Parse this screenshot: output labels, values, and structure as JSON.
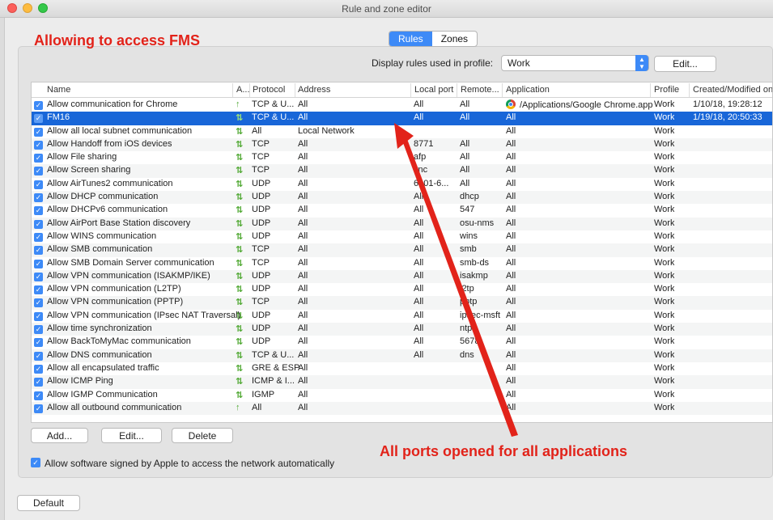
{
  "window": {
    "title": "Rule and zone editor"
  },
  "tabs": {
    "rules": "Rules",
    "zones": "Zones"
  },
  "profile": {
    "label": "Display rules used in profile:",
    "selected": "Work",
    "edit_button": "Edit..."
  },
  "table": {
    "headers": [
      "Name",
      "A...",
      "Protocol",
      "Address",
      "Local port",
      "Remote...",
      "Application",
      "Profile",
      "Created/Modified on"
    ],
    "rows": [
      {
        "name": "Allow communication for Chrome",
        "dir": "up",
        "protocol": "TCP & U...",
        "address": "All",
        "local": "All",
        "remote": "All",
        "app": "/Applications/Google Chrome.app",
        "app_icon": "chrome-icon",
        "profile": "Work",
        "created": "1/10/18, 19:28:12"
      },
      {
        "name": "FM16",
        "dir": "both",
        "protocol": "TCP & U...",
        "address": "All",
        "local": "All",
        "remote": "All",
        "app": "All",
        "profile": "Work",
        "created": "1/19/18, 20:50:33",
        "selected": true
      },
      {
        "name": "Allow all local subnet communication",
        "dir": "both",
        "protocol": "All",
        "address": "Local Network",
        "local": "",
        "remote": "",
        "app": "All",
        "profile": "Work",
        "created": ""
      },
      {
        "name": "Allow Handoff from iOS devices",
        "dir": "both",
        "protocol": "TCP",
        "address": "All",
        "local": "8771",
        "remote": "All",
        "app": "All",
        "profile": "Work",
        "created": ""
      },
      {
        "name": "Allow File sharing",
        "dir": "both",
        "protocol": "TCP",
        "address": "All",
        "local": "afp",
        "remote": "All",
        "app": "All",
        "profile": "Work",
        "created": ""
      },
      {
        "name": "Allow Screen sharing",
        "dir": "both",
        "protocol": "TCP",
        "address": "All",
        "local": "vnc",
        "remote": "All",
        "app": "All",
        "profile": "Work",
        "created": ""
      },
      {
        "name": "Allow AirTunes2 communication",
        "dir": "both",
        "protocol": "UDP",
        "address": "All",
        "local": "6001-6...",
        "remote": "All",
        "app": "All",
        "profile": "Work",
        "created": ""
      },
      {
        "name": "Allow DHCP communication",
        "dir": "both",
        "protocol": "UDP",
        "address": "All",
        "local": "All",
        "remote": "dhcp",
        "app": "All",
        "profile": "Work",
        "created": ""
      },
      {
        "name": "Allow DHCPv6 communication",
        "dir": "both",
        "protocol": "UDP",
        "address": "All",
        "local": "All",
        "remote": "547",
        "app": "All",
        "profile": "Work",
        "created": ""
      },
      {
        "name": "Allow AirPort Base Station discovery",
        "dir": "both",
        "protocol": "UDP",
        "address": "All",
        "local": "All",
        "remote": "osu-nms",
        "app": "All",
        "profile": "Work",
        "created": ""
      },
      {
        "name": "Allow WINS communication",
        "dir": "both",
        "protocol": "UDP",
        "address": "All",
        "local": "All",
        "remote": "wins",
        "app": "All",
        "profile": "Work",
        "created": ""
      },
      {
        "name": "Allow SMB communication",
        "dir": "both",
        "protocol": "TCP",
        "address": "All",
        "local": "All",
        "remote": "smb",
        "app": "All",
        "profile": "Work",
        "created": ""
      },
      {
        "name": "Allow SMB Domain Server communication",
        "dir": "both",
        "protocol": "TCP",
        "address": "All",
        "local": "All",
        "remote": "smb-ds",
        "app": "All",
        "profile": "Work",
        "created": ""
      },
      {
        "name": "Allow VPN communication (ISAKMP/IKE)",
        "dir": "both",
        "protocol": "UDP",
        "address": "All",
        "local": "All",
        "remote": "isakmp",
        "app": "All",
        "profile": "Work",
        "created": ""
      },
      {
        "name": "Allow VPN communication (L2TP)",
        "dir": "both",
        "protocol": "UDP",
        "address": "All",
        "local": "All",
        "remote": "l2tp",
        "app": "All",
        "profile": "Work",
        "created": ""
      },
      {
        "name": "Allow VPN communication (PPTP)",
        "dir": "both",
        "protocol": "TCP",
        "address": "All",
        "local": "All",
        "remote": "pptp",
        "app": "All",
        "profile": "Work",
        "created": ""
      },
      {
        "name": "Allow VPN communication (IPsec NAT Traversal)",
        "dir": "both",
        "protocol": "UDP",
        "address": "All",
        "local": "All",
        "remote": "ipsec-msft",
        "app": "All",
        "profile": "Work",
        "created": ""
      },
      {
        "name": "Allow time synchronization",
        "dir": "both",
        "protocol": "UDP",
        "address": "All",
        "local": "All",
        "remote": "ntp",
        "app": "All",
        "profile": "Work",
        "created": ""
      },
      {
        "name": "Allow BackToMyMac communication",
        "dir": "both",
        "protocol": "UDP",
        "address": "All",
        "local": "All",
        "remote": "5678",
        "app": "All",
        "profile": "Work",
        "created": ""
      },
      {
        "name": "Allow DNS communication",
        "dir": "both",
        "protocol": "TCP & U...",
        "address": "All",
        "local": "All",
        "remote": "dns",
        "app": "All",
        "profile": "Work",
        "created": ""
      },
      {
        "name": "Allow all encapsulated traffic",
        "dir": "both",
        "protocol": "GRE & ESP",
        "address": "All",
        "local": "",
        "remote": "",
        "app": "All",
        "profile": "Work",
        "created": ""
      },
      {
        "name": "Allow ICMP Ping",
        "dir": "both",
        "protocol": "ICMP & I...",
        "address": "All",
        "local": "",
        "remote": "",
        "app": "All",
        "profile": "Work",
        "created": ""
      },
      {
        "name": "Allow IGMP Communication",
        "dir": "both",
        "protocol": "IGMP",
        "address": "All",
        "local": "",
        "remote": "",
        "app": "All",
        "profile": "Work",
        "created": ""
      },
      {
        "name": "Allow all outbound communication",
        "dir": "up",
        "protocol": "All",
        "address": "All",
        "local": "",
        "remote": "",
        "app": "All",
        "profile": "Work",
        "created": ""
      }
    ]
  },
  "buttons": {
    "add": "Add...",
    "edit": "Edit...",
    "delete": "Delete",
    "default": "Default"
  },
  "apple_checkbox_label": "Allow software signed by Apple to access the network automatically",
  "annotations": {
    "title": "Allowing to access FMS",
    "ports": "All ports opened for all applications",
    "color": "#e2231a"
  },
  "colors": {
    "accent": "#3d8af7",
    "selection": "#1866d8",
    "arrow_green": "#52a935"
  }
}
